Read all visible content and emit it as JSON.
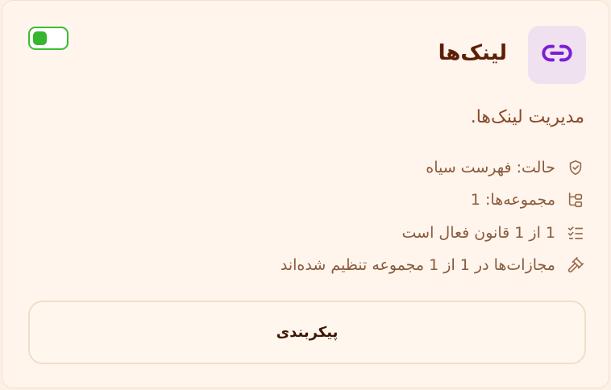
{
  "card": {
    "title": "لینک‌ها",
    "title_icon": "link-icon",
    "description": "مدیریت لینک‌ها.",
    "toggle": {
      "state": "on",
      "color": "#36b62f"
    },
    "info": [
      {
        "icon": "shield-check-icon",
        "text": "حالت: فهرست سیاه"
      },
      {
        "icon": "folder-tree-icon",
        "text": "مجموعه‌ها: 1"
      },
      {
        "icon": "list-checks-icon",
        "text": "1 از 1 قانون فعال است"
      },
      {
        "icon": "gavel-icon",
        "text": "مجازات‌ها در 1 از 1 مجموعه تنظیم شده‌اند"
      }
    ],
    "button_label": "پیکربندی"
  },
  "colors": {
    "accent_purple": "#7b1fd6",
    "title_brown": "#5c1f06",
    "toggle_green": "#36b62f"
  }
}
